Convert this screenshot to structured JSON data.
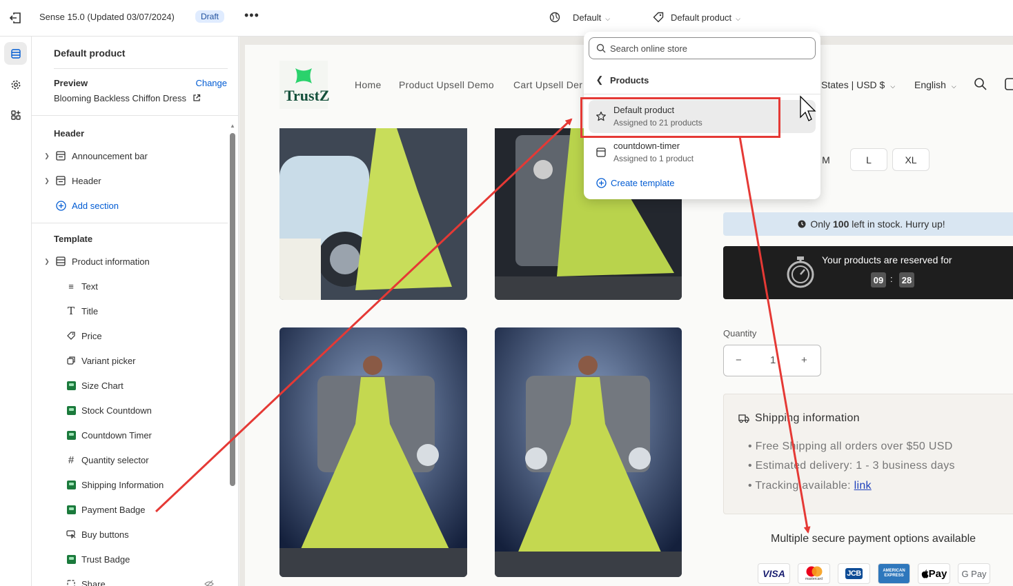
{
  "topbar": {
    "theme_title": "Sense 15.0 (Updated 03/07/2024)",
    "status_badge": "Draft",
    "more_label": "•••",
    "locale_selector": "Default",
    "template_selector": "Default product"
  },
  "sidebar": {
    "heading": "Default product",
    "preview_label": "Preview",
    "change_link": "Change",
    "preview_value": "Blooming Backless Chiffon Dress",
    "header_section": {
      "title": "Header",
      "items": [
        {
          "label": "Announcement bar"
        },
        {
          "label": "Header"
        }
      ],
      "add_section": "Add section"
    },
    "template_section": {
      "title": "Template",
      "group": "Product information",
      "blocks": [
        {
          "label": "Text",
          "icon": "text-lines-icon"
        },
        {
          "label": "Title",
          "icon": "title-t-icon"
        },
        {
          "label": "Price",
          "icon": "price-tag-icon"
        },
        {
          "label": "Variant picker",
          "icon": "variant-picker-icon"
        },
        {
          "label": "Size Chart",
          "icon": "app-block-icon"
        },
        {
          "label": "Stock Countdown",
          "icon": "app-block-icon"
        },
        {
          "label": "Countdown Timer",
          "icon": "app-block-icon"
        },
        {
          "label": "Quantity selector",
          "icon": "hash-icon"
        },
        {
          "label": "Shipping Information",
          "icon": "app-block-icon"
        },
        {
          "label": "Payment Badge",
          "icon": "app-block-icon"
        },
        {
          "label": "Buy buttons",
          "icon": "cursor-button-icon"
        },
        {
          "label": "Trust Badge",
          "icon": "app-block-icon"
        },
        {
          "label": "Share",
          "icon": "share-icon"
        }
      ]
    }
  },
  "dropdown": {
    "search_placeholder": "Search online store",
    "back_label": "Products",
    "items": [
      {
        "name": "Default product",
        "sub": "Assigned to 21 products",
        "selected": true
      },
      {
        "name": "countdown-timer",
        "sub": "Assigned to 1 product",
        "selected": false
      }
    ],
    "create_label": "Create template"
  },
  "store": {
    "logo_text": "TrustZ",
    "nav": [
      "Home",
      "Product Upsell Demo",
      "Cart Upsell Der"
    ],
    "currency": "States | USD $",
    "language": "English",
    "sizes": [
      "M",
      "L",
      "XL"
    ],
    "stock_prefix": "Only ",
    "stock_count": "100",
    "stock_suffix": " left in stock. Hurry up!",
    "timer_label": "Your products are reserved for",
    "timer_minutes": "09",
    "timer_sep": ":",
    "timer_seconds": "28",
    "quantity_label": "Quantity",
    "quantity_value": "1",
    "qty_minus": "−",
    "qty_plus": "+",
    "shipping_title": "Shipping information",
    "shipping_items": [
      "Free Shipping all orders over $50 USD",
      "Estimated delivery: 1 - 3 business days",
      "Tracking available: "
    ],
    "tracking_link": "link",
    "payment_text": "Multiple secure payment options available",
    "payment_cards": [
      "VISA",
      "mastercard",
      "JCB",
      "AMERICAN EXPRESS",
      "Pay",
      "G Pay"
    ]
  },
  "colors": {
    "accent_blue": "#005bd3",
    "annotation_red": "#e53935",
    "timer_bg": "#1e1e1e",
    "stock_bg": "#d9e6f2"
  }
}
